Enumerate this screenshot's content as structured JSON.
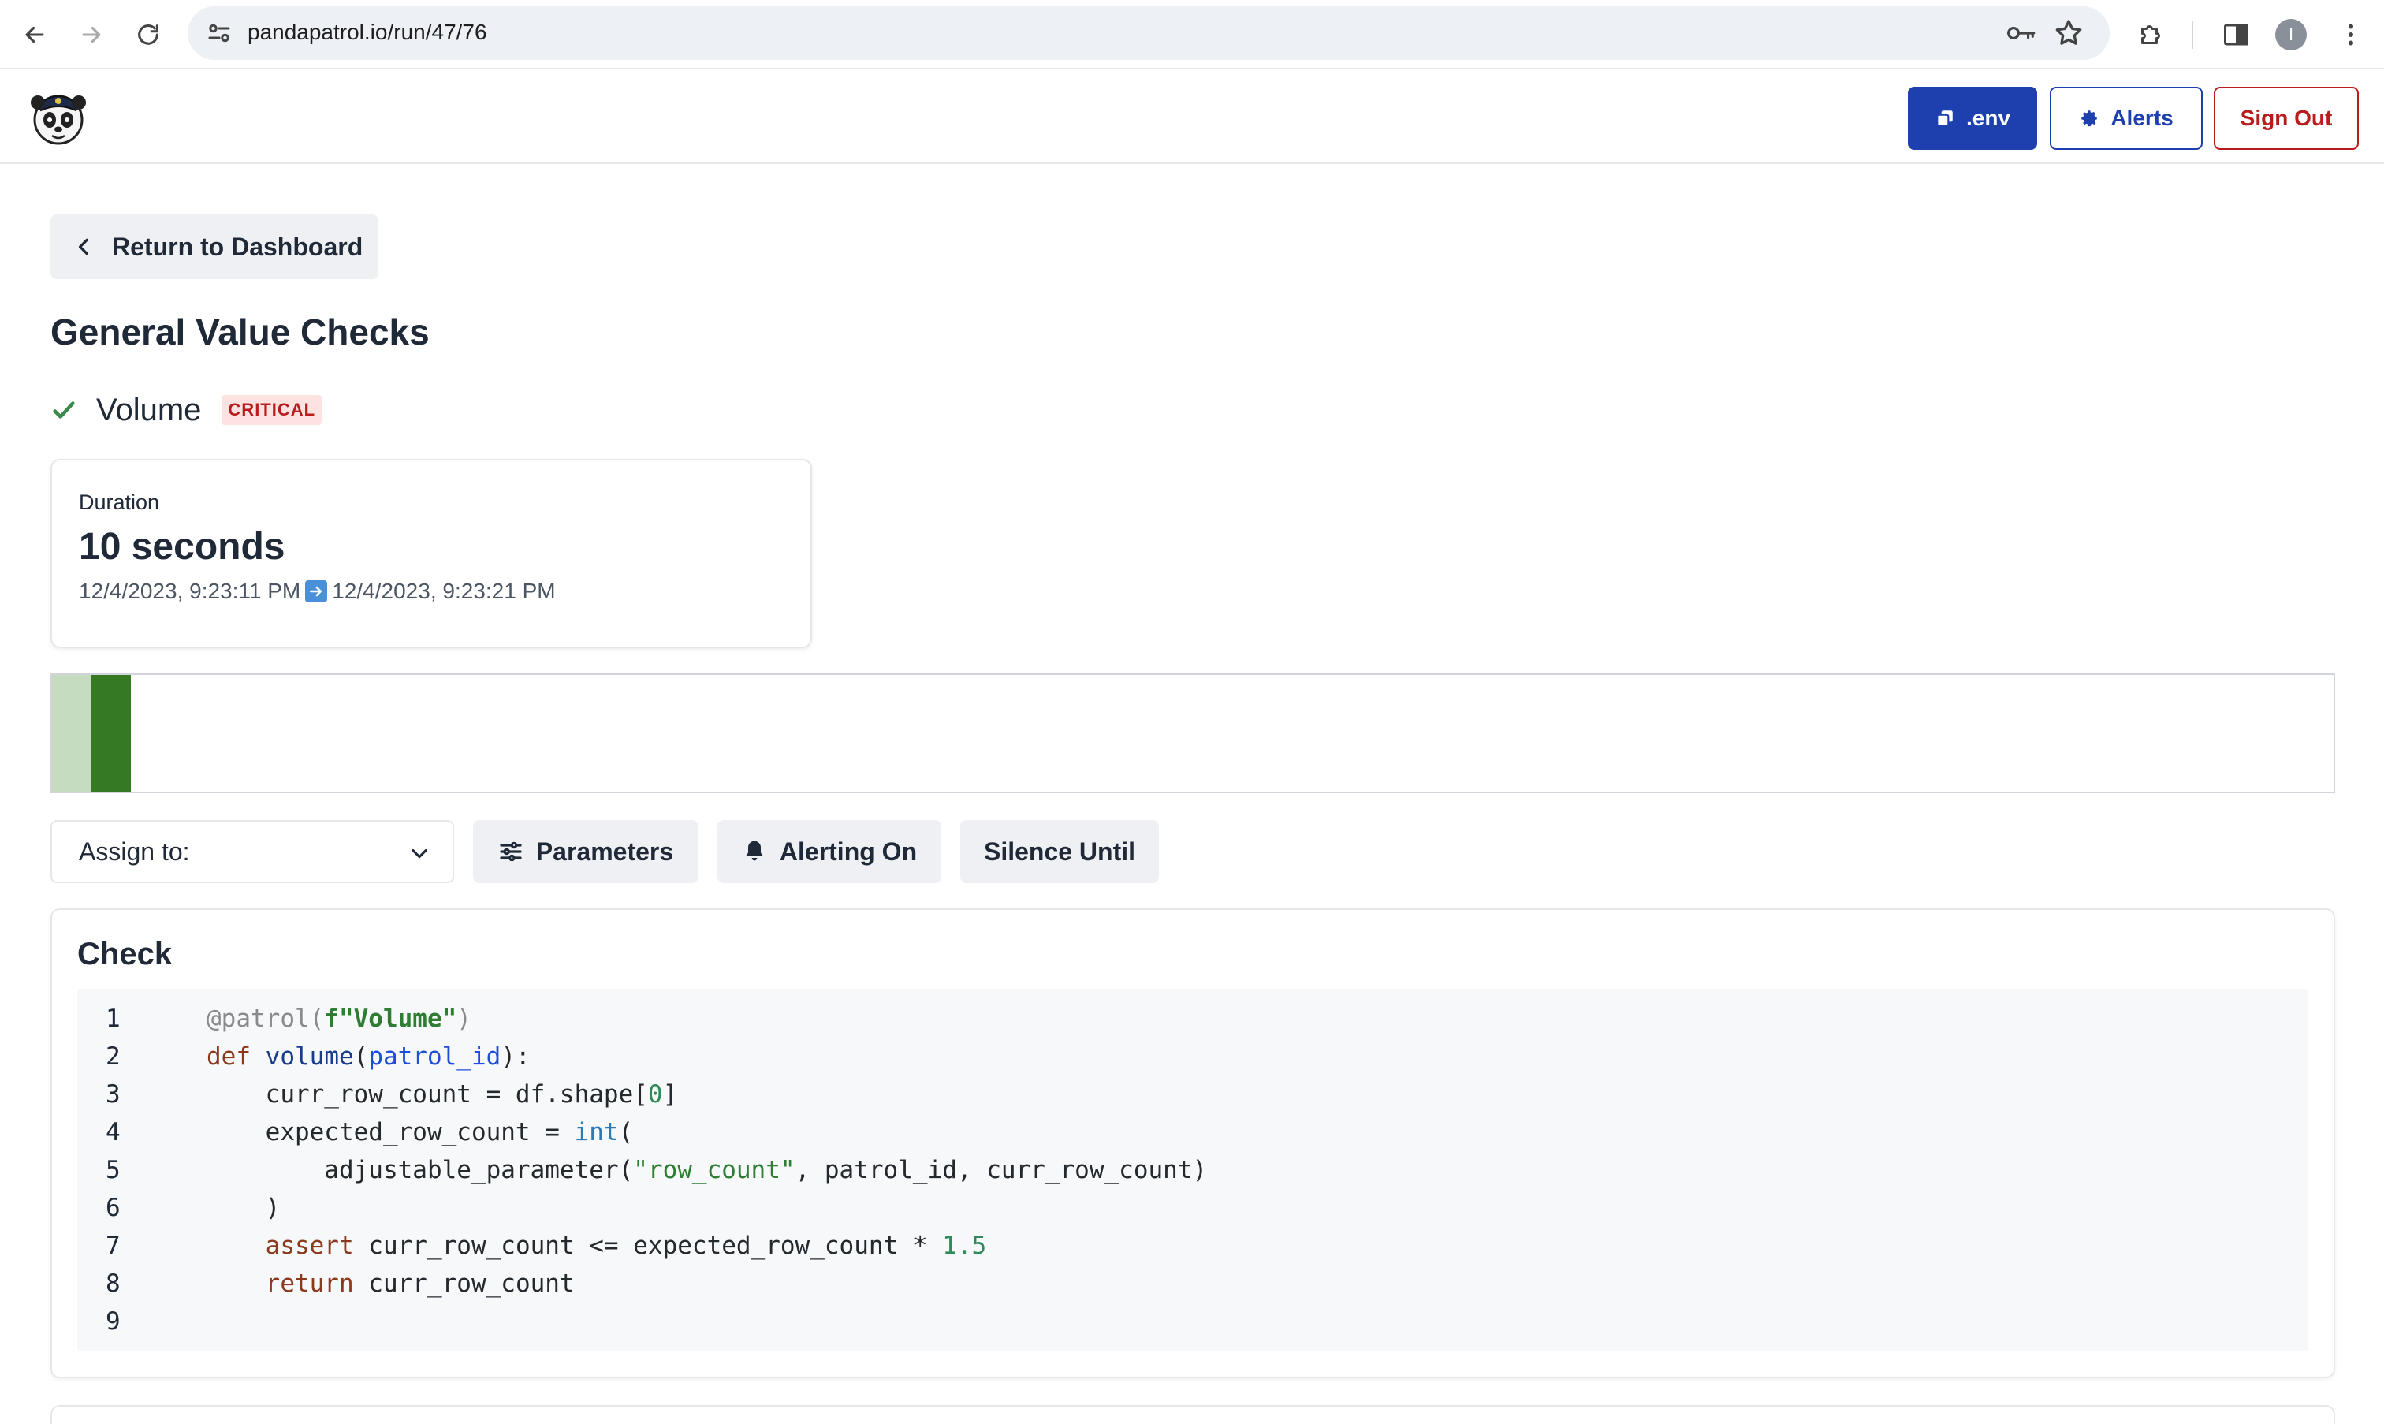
{
  "browser": {
    "url": "pandapatrol.io/run/47/76",
    "avatar_initial": "I"
  },
  "header": {
    "env_label": ".env",
    "alerts_label": "Alerts",
    "signout_label": "Sign Out",
    "colors": {
      "primary": "#1e40af",
      "danger": "#b91c1c"
    }
  },
  "main": {
    "return_label": "Return to Dashboard",
    "title": "General Value Checks",
    "check": {
      "name": "Volume",
      "status": "passed",
      "severity": "CRITICAL"
    },
    "duration": {
      "label": "Duration",
      "value": "10 seconds",
      "start": "12/4/2023, 9:23:11 PM",
      "end": "12/4/2023, 9:23:21 PM"
    },
    "timeline": {
      "runs": [
        {
          "state": "pass-faded",
          "color": "#c5dcc0"
        },
        {
          "state": "pass",
          "color": "#357a22"
        }
      ]
    },
    "actions": {
      "assign_label": "Assign to:",
      "parameters_label": "Parameters",
      "alerting_label": "Alerting On",
      "silence_label": "Silence Until"
    },
    "check_panel": {
      "title": "Check",
      "line_numbers": [
        "1",
        "2",
        "3",
        "4",
        "5",
        "6",
        "7",
        "8",
        "9"
      ],
      "code": {
        "l1_dec": "@patrol(",
        "l1_fpref": "f",
        "l1_str": "\"Volume\"",
        "l1_close": ")",
        "l2_kw": "def",
        "l2_fn": "volume",
        "l2_open": "(",
        "l2_param": "patrol_id",
        "l2_close": "):",
        "l3_a": "    curr_row_count = df.shape[",
        "l3_num": "0",
        "l3_b": "]",
        "l4_a": "    expected_row_count = ",
        "l4_builtin": "int",
        "l4_b": "(",
        "l5_a": "        adjustable_parameter(",
        "l5_str": "\"row_count\"",
        "l5_b": ", patrol_id, curr_row_count)",
        "l6": "    )",
        "l7_kw": "    assert",
        "l7_a": " curr_row_count <= expected_row_count * ",
        "l7_num": "1.5",
        "l8_kw": "    return",
        "l8_a": " curr_row_count"
      }
    }
  }
}
